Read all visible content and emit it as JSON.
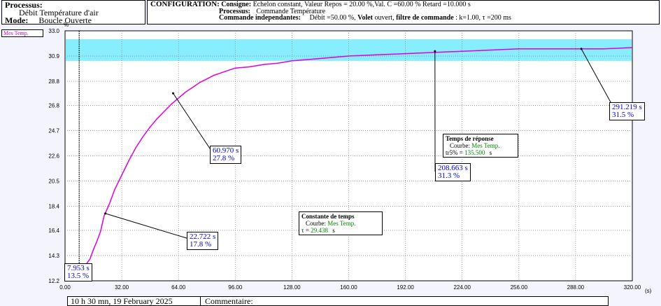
{
  "header": {
    "process_label": "Processus:",
    "process_value": "Débit Température d'air",
    "mode_label": "Mode:",
    "mode_value": "Boucle Ouverte"
  },
  "config": {
    "title": "CONFIGURATION:",
    "consigne_label": "Consigne:",
    "consigne_value": "Echelon constant, Valeur Repos = 20.00 %,Val. C =60.00 % Retard =10.000 s",
    "processus_label": "Processus:",
    "processus_value": "Commande Température",
    "commande_label": "Commande independantes:",
    "commande_debit": "Débit =50.00 %,",
    "volet_label": "Volet",
    "volet_value": "ouvert,",
    "filtre_label": "filtre de commande",
    "filtre_value": ": k=1.00, τ =200 ms"
  },
  "legend": {
    "series_name": "Mes Temp."
  },
  "colors": {
    "series": "#dd00dd",
    "band": "#88eeff",
    "text_blue": "#0000cc",
    "text_green": "#008800"
  },
  "chart_data": {
    "type": "line",
    "xlabel": "(s)",
    "ylabel": "%",
    "xlim": [
      0,
      320
    ],
    "ylim": [
      12.2,
      33.0
    ],
    "x_ticks": [
      "0.00",
      "32.00",
      "64.00",
      "96.00",
      "128.00",
      "160.00",
      "192.00",
      "224.00",
      "256.00",
      "288.00",
      "320.00"
    ],
    "y_ticks": [
      "33.0",
      "30.9",
      "28.8",
      "26.8",
      "24.7",
      "22.6",
      "20.5",
      "18.4",
      "16.4",
      "14.3",
      "12.2"
    ],
    "grid": true,
    "band": [
      30.5,
      32.3
    ],
    "vertical_marker_x": 7.953,
    "series": [
      {
        "name": "Mes Temp.",
        "points": [
          [
            0,
            13.5
          ],
          [
            6,
            13.5
          ],
          [
            8,
            13.6
          ],
          [
            10,
            13.5
          ],
          [
            12,
            13.6
          ],
          [
            14,
            14.0
          ],
          [
            16,
            14.8
          ],
          [
            18,
            15.5
          ],
          [
            20,
            16.3
          ],
          [
            22,
            17.6
          ],
          [
            25,
            18.6
          ],
          [
            28,
            19.8
          ],
          [
            32,
            21.0
          ],
          [
            36,
            22.2
          ],
          [
            40,
            23.3
          ],
          [
            44,
            24.2
          ],
          [
            48,
            25.0
          ],
          [
            52,
            25.7
          ],
          [
            56,
            26.3
          ],
          [
            60,
            26.9
          ],
          [
            64,
            27.4
          ],
          [
            68,
            27.9
          ],
          [
            72,
            28.3
          ],
          [
            76,
            28.7
          ],
          [
            80,
            29.0
          ],
          [
            84,
            29.3
          ],
          [
            88,
            29.5
          ],
          [
            92,
            29.7
          ],
          [
            96,
            29.9
          ],
          [
            104,
            30.0
          ],
          [
            112,
            30.2
          ],
          [
            120,
            30.3
          ],
          [
            128,
            30.5
          ],
          [
            136,
            30.6
          ],
          [
            144,
            30.7
          ],
          [
            152,
            30.8
          ],
          [
            160,
            30.9
          ],
          [
            176,
            31.0
          ],
          [
            192,
            31.1
          ],
          [
            208,
            31.2
          ],
          [
            224,
            31.3
          ],
          [
            240,
            31.4
          ],
          [
            256,
            31.5
          ],
          [
            272,
            31.5
          ],
          [
            288,
            31.5
          ],
          [
            304,
            31.5
          ],
          [
            320,
            31.6
          ]
        ]
      }
    ],
    "annotations": [
      {
        "time": "7.953 s",
        "value": "13.5 %",
        "x": 7.953,
        "y": 13.5
      },
      {
        "time": "22.722 s",
        "value": "17.8 %",
        "x": 22.722,
        "y": 17.8
      },
      {
        "time": "60.970 s",
        "value": "27.8 %",
        "x": 60.97,
        "y": 27.8
      },
      {
        "time": "208.663 s",
        "value": "31.3 %",
        "x": 208.663,
        "y": 31.3
      },
      {
        "time": "291.219 s",
        "value": "31.5 %",
        "x": 291.219,
        "y": 31.5
      }
    ]
  },
  "results": {
    "tau_box": {
      "title": "Constante de temps",
      "courbe_label": "Courbe:",
      "courbe_value": "Mes Temp.",
      "param_label": "τ =",
      "param_value": "29.438",
      "unit": "s"
    },
    "tr_box": {
      "title": "Temps de réponse",
      "courbe_label": "Courbe:",
      "courbe_value": "Mes Temp.",
      "param_label": "tr5% =",
      "param_value": "135.500",
      "unit": "s"
    }
  },
  "footer": {
    "datetime": "10 h 30 mn, 19 February 2025",
    "comment_label": "Commentaire:"
  }
}
